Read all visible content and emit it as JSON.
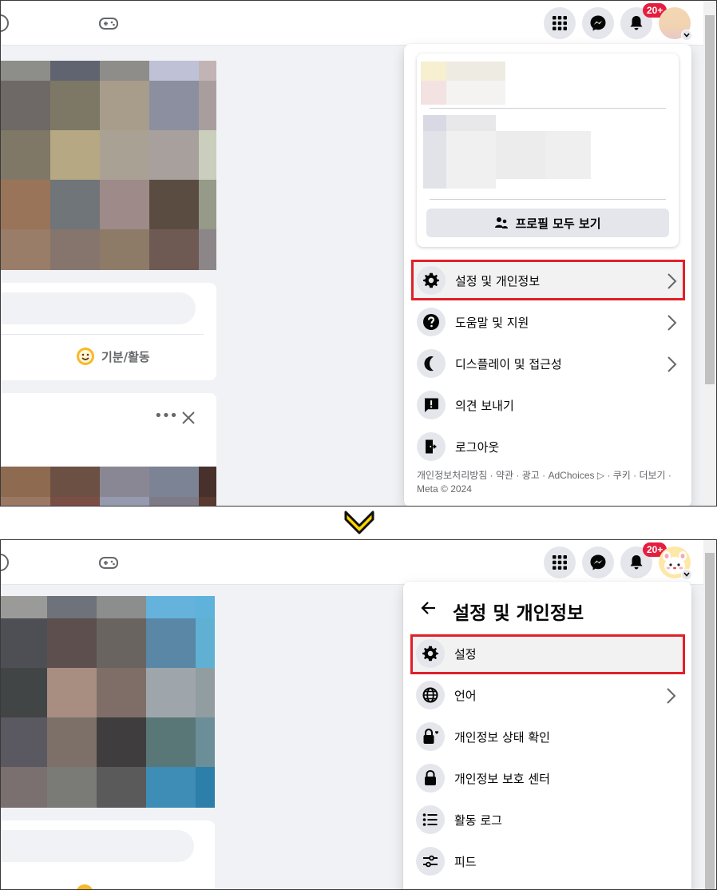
{
  "colors": {
    "page_bg": "#f0f2f5",
    "card_bg": "#ffffff",
    "icon_bg": "#e4e6eb",
    "badge": "#e41e3f",
    "highlight_box": "#e0202a",
    "arrow_yellow": "#ffd400"
  },
  "top_screen": {
    "header": {
      "badge": "20+",
      "icons": [
        "game-controller-icon",
        "apps-grid-icon",
        "messenger-icon",
        "bell-icon",
        "avatar-icon"
      ]
    },
    "composer": {
      "feeling_label": "기분/활동"
    },
    "account_menu": {
      "see_all_profiles": "프로필 모두 보기",
      "items": [
        {
          "label": "설정 및 개인정보",
          "icon": "gear-icon",
          "has_chevron": true
        },
        {
          "label": "도움말 및 지원",
          "icon": "help-icon",
          "has_chevron": true
        },
        {
          "label": "디스플레이 및 접근성",
          "icon": "moon-icon",
          "has_chevron": true
        },
        {
          "label": "의견 보내기",
          "icon": "feedback-icon",
          "has_chevron": false
        },
        {
          "label": "로그아웃",
          "icon": "logout-icon",
          "has_chevron": false
        }
      ],
      "footer": "개인정보처리방침 · 약관 · 광고 · AdChoices ▷ · 쿠키 · 더보기 · Meta © 2024"
    }
  },
  "bottom_screen": {
    "header": {
      "badge": "20+"
    },
    "settings_menu": {
      "title": "설정 및 개인정보",
      "items": [
        {
          "label": "설정",
          "icon": "gear-icon",
          "has_chevron": false
        },
        {
          "label": "언어",
          "icon": "globe-icon",
          "has_chevron": true
        },
        {
          "label": "개인정보 상태 확인",
          "icon": "lock-heart-icon",
          "has_chevron": false
        },
        {
          "label": "개인정보 보호 센터",
          "icon": "lock-icon",
          "has_chevron": false
        },
        {
          "label": "활동 로그",
          "icon": "list-icon",
          "has_chevron": false
        },
        {
          "label": "피드",
          "icon": "sliders-icon",
          "has_chevron": false
        }
      ]
    }
  }
}
